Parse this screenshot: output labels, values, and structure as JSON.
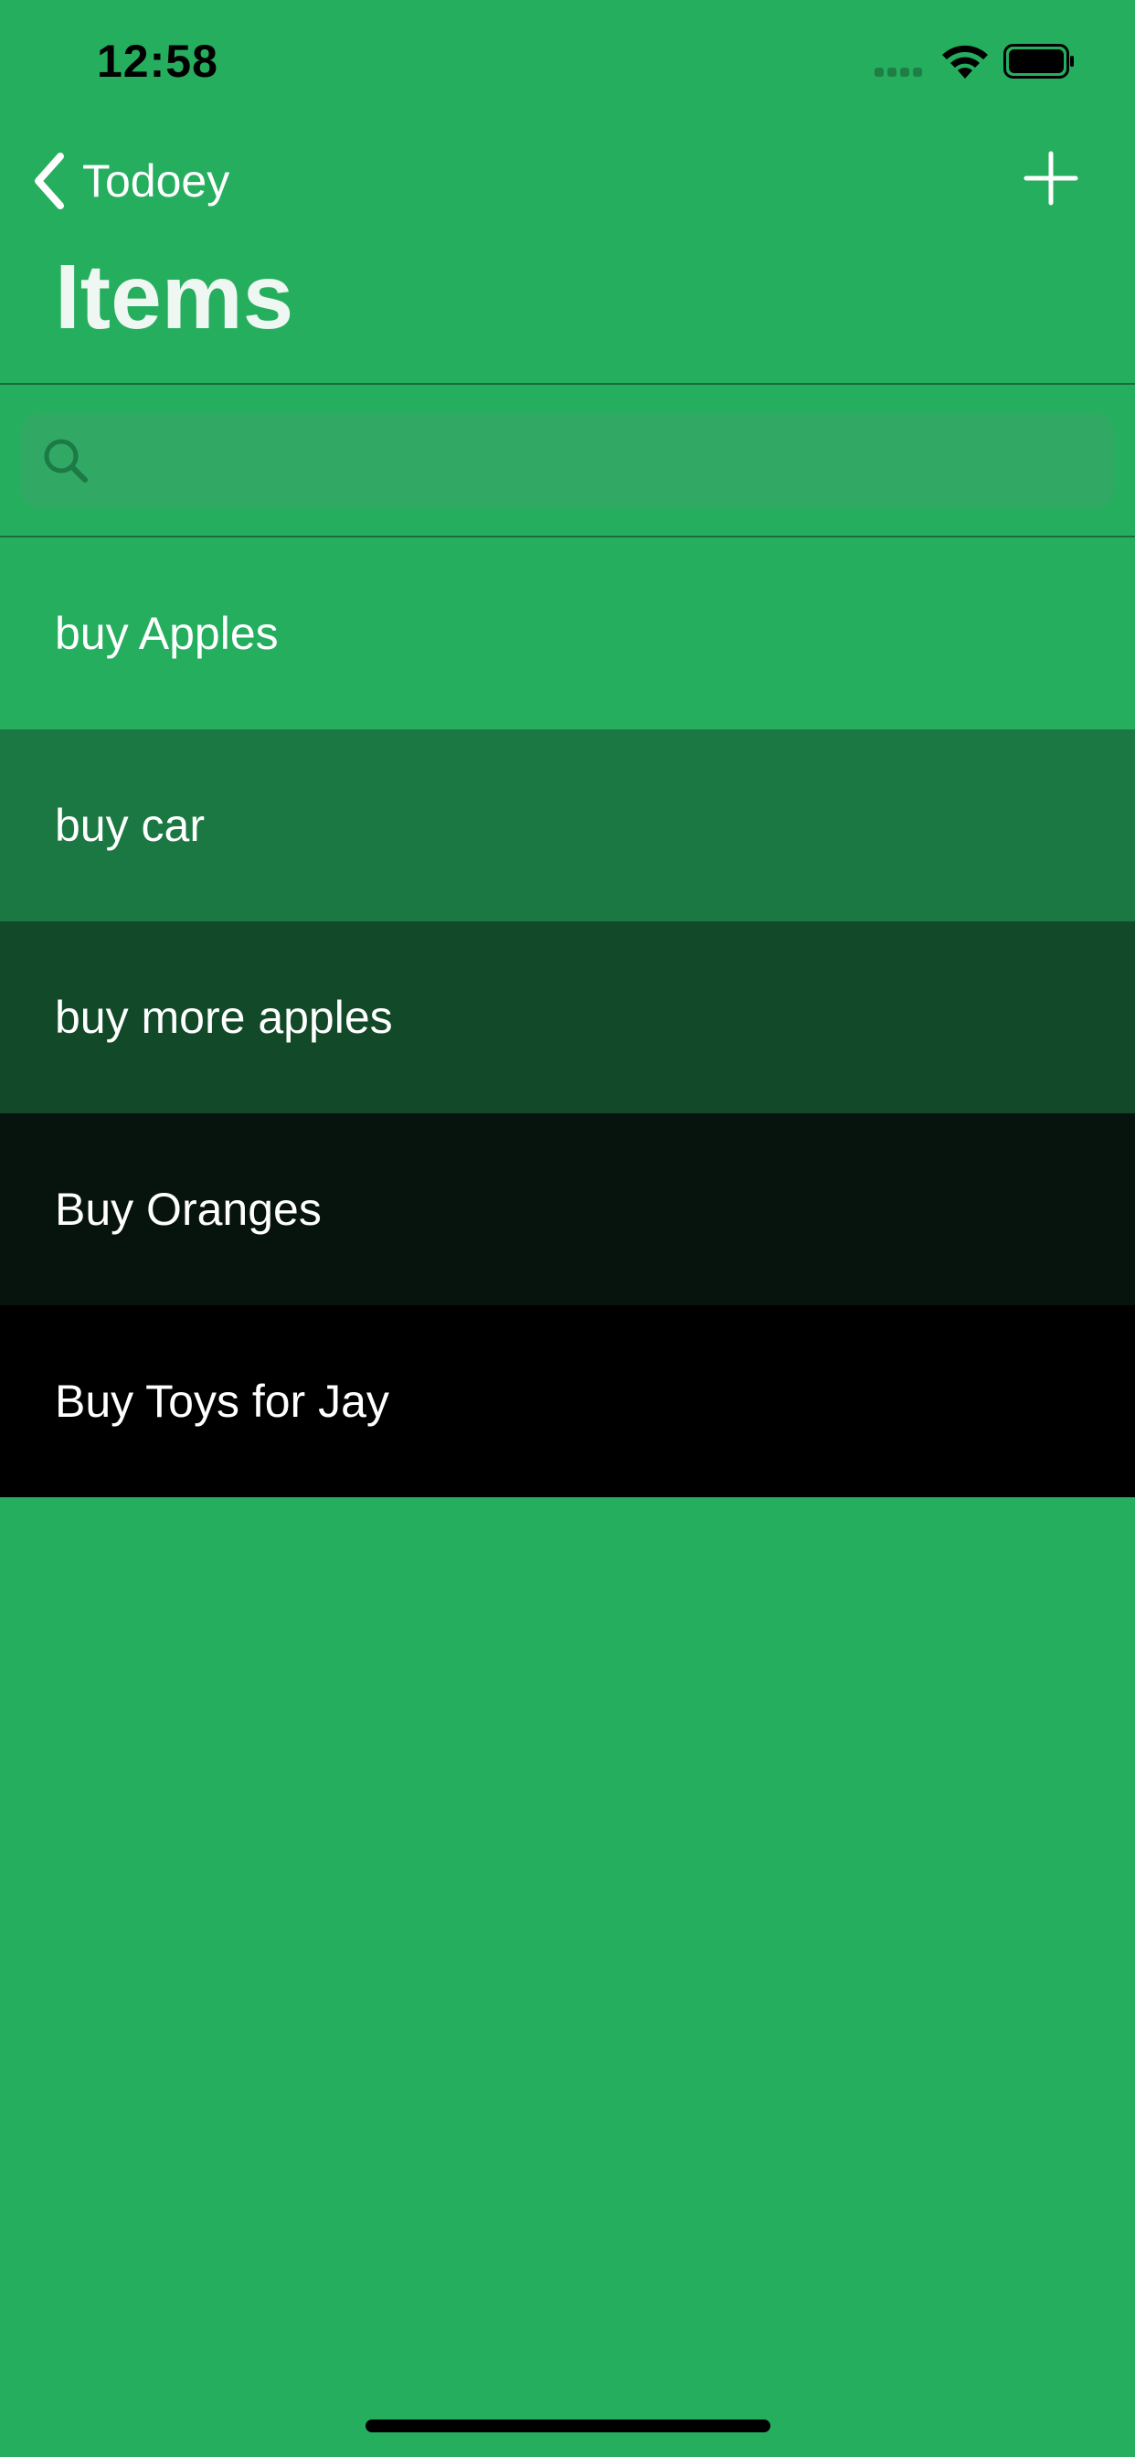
{
  "status_bar": {
    "time": "12:58",
    "icons": [
      "cellular-signal-icon",
      "wifi-icon",
      "battery-icon"
    ]
  },
  "nav": {
    "back_label": "Todoey",
    "back_icon": "chevron-left-icon",
    "add_icon": "plus-icon",
    "title": "Items"
  },
  "search": {
    "placeholder": "",
    "value": "",
    "icon": "search-icon"
  },
  "items": [
    {
      "label": "buy Apples",
      "color": "#26ae5f"
    },
    {
      "label": "buy car",
      "color": "#1c7843"
    },
    {
      "label": "buy more apples",
      "color": "#124a29"
    },
    {
      "label": "Buy Oranges",
      "color": "#07140d"
    },
    {
      "label": "Buy Toys for Jay",
      "color": "#000000"
    }
  ],
  "colors": {
    "background": "#26ae5f",
    "title_text": "#eef7f1",
    "item_text": "#ffffff",
    "search_field": "#31a864"
  }
}
